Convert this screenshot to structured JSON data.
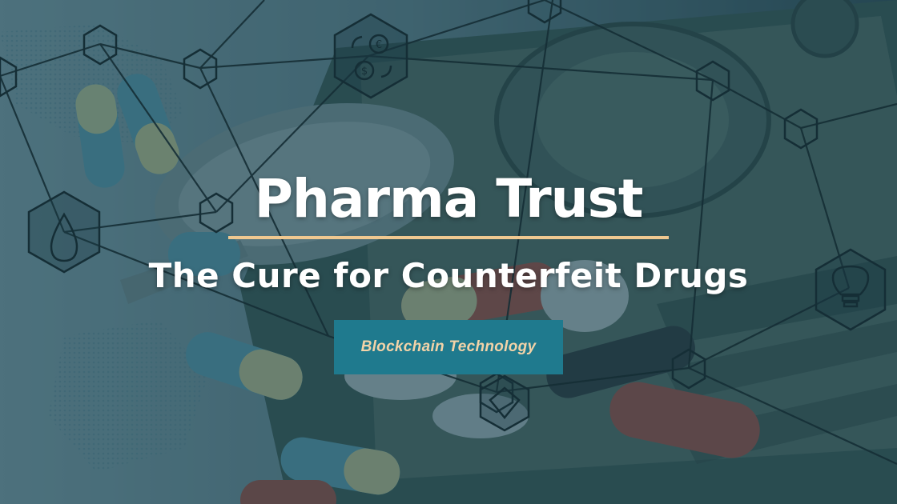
{
  "slide": {
    "title": "Pharma Trust",
    "subtitle": "The Cure for Counterfeit Drugs",
    "badge_label": "Blockchain Technology"
  },
  "icons": [
    "currency-exchange-icon",
    "droplet-icon",
    "lightbulb-icon",
    "hexagon-network-node-icon"
  ],
  "colors": {
    "title_text": "#ffffff",
    "accent_rule": "#f0c890",
    "badge_background": "#1f7a8e",
    "badge_text": "#f3d3a8",
    "overlay_tint": "#2a5a66"
  }
}
